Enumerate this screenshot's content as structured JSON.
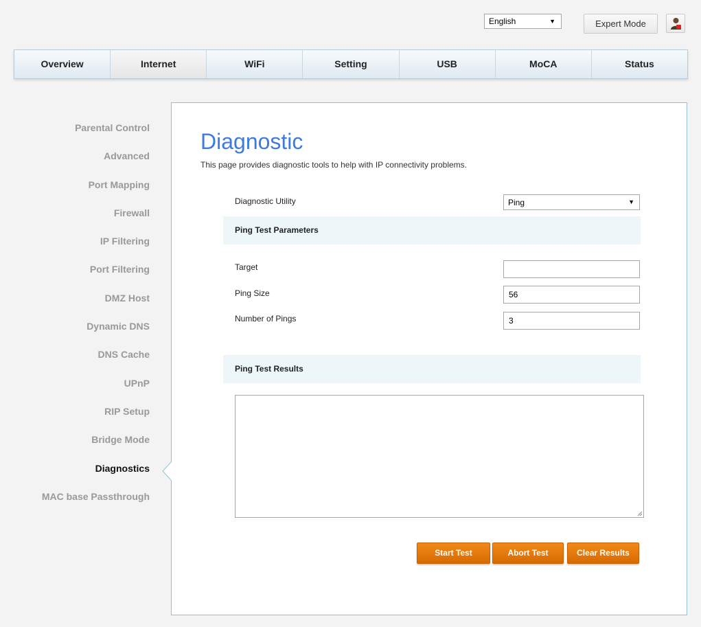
{
  "header": {
    "language_value": "English",
    "expert_mode_label": "Expert Mode",
    "user_icon": "user-icon"
  },
  "nav": {
    "tabs": [
      {
        "label": "Overview"
      },
      {
        "label": "Internet",
        "active": true
      },
      {
        "label": "WiFi"
      },
      {
        "label": "Setting"
      },
      {
        "label": "USB"
      },
      {
        "label": "MoCA"
      },
      {
        "label": "Status"
      }
    ]
  },
  "sidebar": {
    "items": [
      {
        "label": "Parental Control"
      },
      {
        "label": "Advanced"
      },
      {
        "label": "Port Mapping"
      },
      {
        "label": "Firewall"
      },
      {
        "label": "IP Filtering"
      },
      {
        "label": "Port Filtering"
      },
      {
        "label": "DMZ Host"
      },
      {
        "label": "Dynamic DNS"
      },
      {
        "label": "DNS Cache"
      },
      {
        "label": "UPnP"
      },
      {
        "label": "RIP Setup"
      },
      {
        "label": "Bridge Mode"
      },
      {
        "label": "Diagnostics",
        "active": true
      },
      {
        "label": "MAC base Passthrough"
      }
    ]
  },
  "main": {
    "title": "Diagnostic",
    "description": "This page provides diagnostic tools to help with IP connectivity problems.",
    "utility_label": "Diagnostic Utility",
    "utility_value": "Ping",
    "params_heading": "Ping Test Parameters",
    "target_label": "Target",
    "target_value": "",
    "ping_size_label": "Ping Size",
    "ping_size_value": "56",
    "num_pings_label": "Number of Pings",
    "num_pings_value": "3",
    "results_heading": "Ping Test Results",
    "results_value": "",
    "buttons": {
      "start": "Start Test",
      "abort": "Abort Test",
      "clear": "Clear Results"
    }
  },
  "colors": {
    "title": "#3d7be0",
    "button": "#e57a0c",
    "section_bg": "#edf7f9",
    "panel_border": "#8fc1d8"
  }
}
